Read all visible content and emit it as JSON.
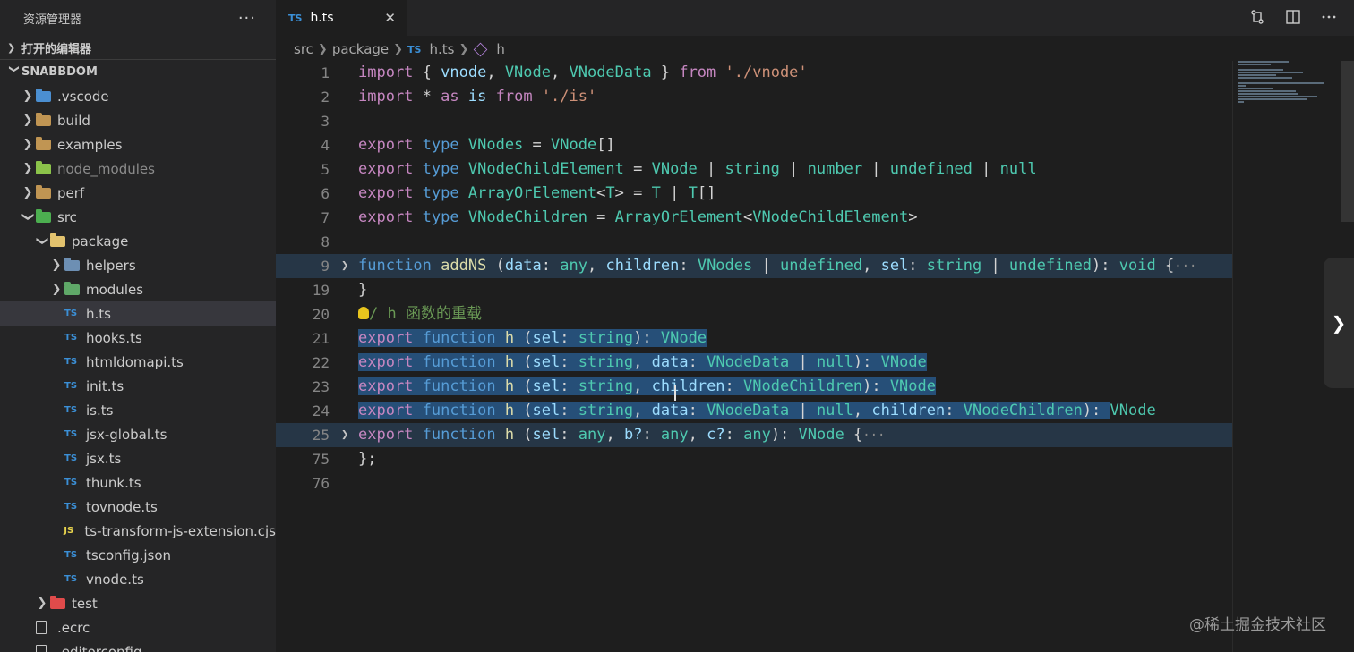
{
  "sidebar": {
    "title": "资源管理器",
    "more": "···",
    "open_editors": "打开的编辑器",
    "root": "SNABBDOM",
    "items": [
      {
        "label": ".vscode",
        "icon": "folder-vscode-icon"
      },
      {
        "label": "build",
        "icon": "folder-icon"
      },
      {
        "label": "examples",
        "icon": "folder-icon"
      },
      {
        "label": "node_modules",
        "icon": "folder-node-icon"
      },
      {
        "label": "perf",
        "icon": "folder-icon"
      },
      {
        "label": "src",
        "icon": "folder-src-icon"
      },
      {
        "label": "package",
        "icon": "folder-open-icon"
      },
      {
        "label": "helpers",
        "icon": "folder-helpers-icon"
      },
      {
        "label": "modules",
        "icon": "folder-modules-icon"
      },
      {
        "label": "h.ts",
        "icon": "ts-file-icon",
        "badge": "TS"
      },
      {
        "label": "hooks.ts",
        "icon": "ts-file-icon",
        "badge": "TS"
      },
      {
        "label": "htmldomapi.ts",
        "icon": "ts-file-icon",
        "badge": "TS"
      },
      {
        "label": "init.ts",
        "icon": "ts-file-icon",
        "badge": "TS"
      },
      {
        "label": "is.ts",
        "icon": "ts-file-icon",
        "badge": "TS"
      },
      {
        "label": "jsx-global.ts",
        "icon": "ts-file-icon",
        "badge": "TS"
      },
      {
        "label": "jsx.ts",
        "icon": "ts-file-icon",
        "badge": "TS"
      },
      {
        "label": "thunk.ts",
        "icon": "ts-file-icon",
        "badge": "TS"
      },
      {
        "label": "tovnode.ts",
        "icon": "ts-file-icon",
        "badge": "TS"
      },
      {
        "label": "ts-transform-js-extension.cjs",
        "icon": "js-file-icon",
        "badge": "JS"
      },
      {
        "label": "tsconfig.json",
        "icon": "tsconfig-file-icon",
        "badge": "TS"
      },
      {
        "label": "vnode.ts",
        "icon": "ts-file-icon",
        "badge": "TS"
      },
      {
        "label": "test",
        "icon": "folder-test-icon"
      },
      {
        "label": ".ecrc",
        "icon": "file-icon"
      },
      {
        "label": ".editorconfig",
        "icon": "file-icon"
      }
    ]
  },
  "tab": {
    "badge": "TS",
    "label": "h.ts",
    "close": "✕"
  },
  "breadcrumb": {
    "a": "src",
    "b": "package",
    "badge": "TS",
    "c": "h.ts",
    "d": "h"
  },
  "editor": {
    "line_numbers": [
      "1",
      "2",
      "3",
      "4",
      "5",
      "6",
      "7",
      "8",
      "9",
      "19",
      "20",
      "21",
      "22",
      "23",
      "24",
      "25",
      "75",
      "76"
    ],
    "code": {
      "l1": [
        "import",
        " { ",
        "vnode",
        ", ",
        "VNode",
        ", ",
        "VNodeData",
        " } ",
        "from",
        " ",
        "'./vnode'"
      ],
      "l2": [
        "import",
        " * ",
        "as",
        " ",
        "is",
        " ",
        "from",
        " ",
        "'./is'"
      ],
      "l4": [
        "export",
        " ",
        "type",
        " ",
        "VNodes",
        " = ",
        "VNode",
        "[]"
      ],
      "l5": [
        "export",
        " ",
        "type",
        " ",
        "VNodeChildElement",
        " = ",
        "VNode",
        " | ",
        "string",
        " | ",
        "number",
        " | ",
        "undefined",
        " | ",
        "null"
      ],
      "l6": [
        "export",
        " ",
        "type",
        " ",
        "ArrayOrElement",
        "<",
        "T",
        "> = ",
        "T",
        " | ",
        "T",
        "[]"
      ],
      "l7": [
        "export",
        " ",
        "type",
        " ",
        "VNodeChildren",
        " = ",
        "ArrayOrElement",
        "<",
        "VNodeChildElement",
        ">"
      ],
      "l9": [
        "function",
        " ",
        "addNS",
        " (",
        "data",
        ": ",
        "any",
        ", ",
        "children",
        ": ",
        "VNodes",
        " | ",
        "undefined",
        ", ",
        "sel",
        ": ",
        "string",
        " | ",
        "undefined",
        "): ",
        "void",
        " {",
        "···"
      ],
      "l19": [
        "}"
      ],
      "l20": [
        "/",
        " h 函数的重载"
      ],
      "l21": [
        "export",
        " ",
        "function",
        " ",
        "h",
        " (",
        "sel",
        ": ",
        "string",
        "): ",
        "VNode"
      ],
      "l22": [
        "export",
        " ",
        "function",
        " ",
        "h",
        " (",
        "sel",
        ": ",
        "string",
        ", ",
        "data",
        ": ",
        "VNodeData",
        " | ",
        "null",
        "): ",
        "VNode"
      ],
      "l23": [
        "export",
        " ",
        "function",
        " ",
        "h",
        " (",
        "sel",
        ": ",
        "string",
        ", ",
        "children",
        ": ",
        "VNodeChildren",
        "): ",
        "VNode"
      ],
      "l24": [
        "export",
        " ",
        "function",
        " ",
        "h",
        " (",
        "sel",
        ": ",
        "string",
        ", ",
        "data",
        ": ",
        "VNodeData",
        " | ",
        "null",
        ", ",
        "children",
        ": ",
        "VNodeChildren",
        "): ",
        "VNode"
      ],
      "l25": [
        "export",
        " ",
        "function",
        " ",
        "h",
        " (",
        "sel",
        ": ",
        "any",
        ", ",
        "b?",
        ": ",
        "any",
        ", ",
        "c?",
        ": ",
        "any",
        "): ",
        "VNode",
        " {",
        "···"
      ],
      "l75": [
        "};"
      ]
    }
  },
  "watermark": "@稀土掘金技术社区",
  "colors": {
    "keyword": "#c586c0",
    "storage": "#569cd6",
    "type": "#4ec9b0",
    "variable": "#9cdcfe",
    "function": "#dcdcaa",
    "string": "#ce9178",
    "comment": "#6a9955",
    "selection": "#264f78"
  }
}
